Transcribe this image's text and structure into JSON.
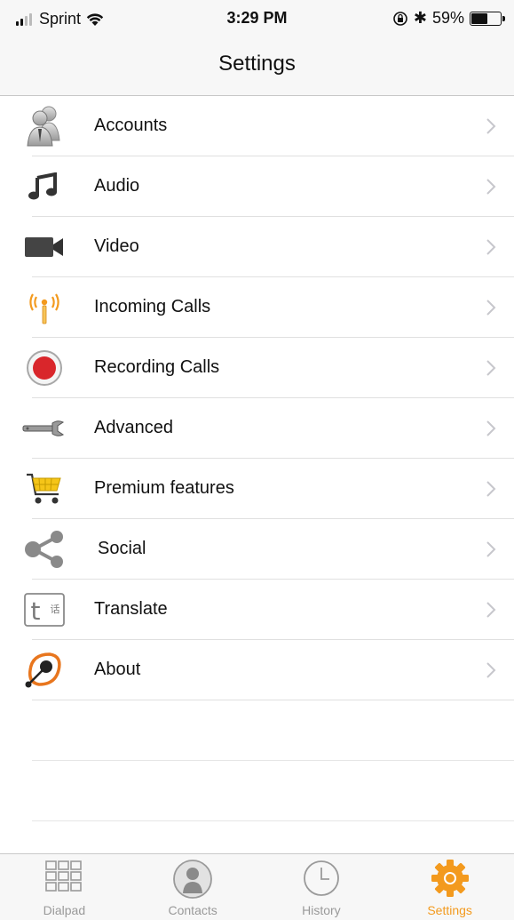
{
  "status_bar": {
    "carrier": "Sprint",
    "time": "3:29 PM",
    "battery_percent": "59%",
    "battery_level": 0.59
  },
  "nav": {
    "title": "Settings"
  },
  "settings": {
    "items": [
      {
        "label": "Accounts",
        "icon": "accounts-icon"
      },
      {
        "label": "Audio",
        "icon": "music-note-icon"
      },
      {
        "label": "Video",
        "icon": "video-camera-icon"
      },
      {
        "label": "Incoming Calls",
        "icon": "antenna-icon"
      },
      {
        "label": "Recording Calls",
        "icon": "record-icon"
      },
      {
        "label": "Advanced",
        "icon": "wrench-icon"
      },
      {
        "label": "Premium features",
        "icon": "shopping-cart-icon"
      },
      {
        "label": "Social",
        "icon": "share-icon"
      },
      {
        "label": "Translate",
        "icon": "translate-icon"
      },
      {
        "label": "About",
        "icon": "about-icon"
      }
    ]
  },
  "tabs": [
    {
      "label": "Dialpad",
      "icon": "dialpad-icon",
      "active": false
    },
    {
      "label": "Contacts",
      "icon": "contacts-icon",
      "active": false
    },
    {
      "label": "History",
      "icon": "clock-icon",
      "active": false
    },
    {
      "label": "Settings",
      "icon": "gear-icon",
      "active": true
    }
  ],
  "colors": {
    "accent": "#f39a1e",
    "record_red": "#d9262b",
    "inactive_tab": "#999999"
  }
}
